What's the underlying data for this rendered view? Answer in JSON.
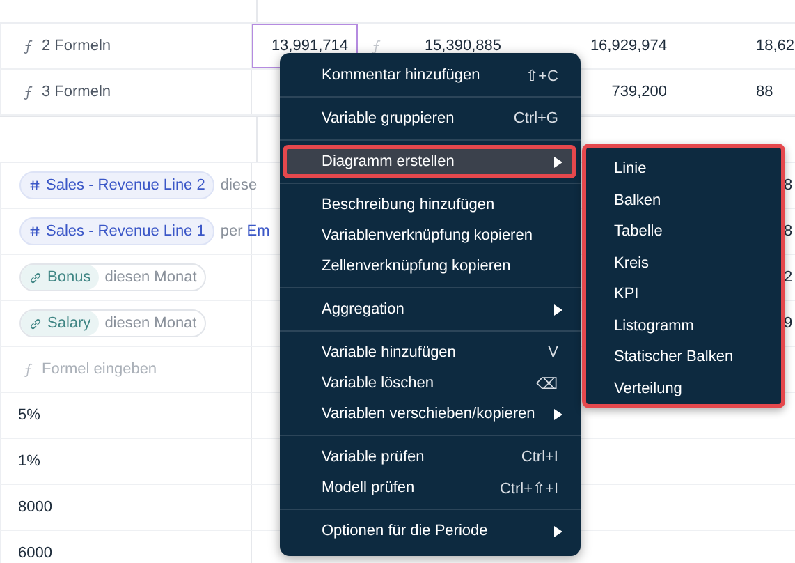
{
  "grid": {
    "groups": [
      {
        "rows": [
          {
            "kind": "formula",
            "label": "2 Formeln",
            "cells": [
              {
                "text": "13,991,714",
                "selected": true,
                "kind": "value"
              },
              {
                "text": "15,390,885",
                "selected": false,
                "kind": "formula"
              },
              {
                "text": "16,929,974",
                "selected": false,
                "kind": "value"
              },
              {
                "text": "18,62",
                "selected": false,
                "kind": "value"
              }
            ]
          },
          {
            "kind": "formula",
            "label": "3 Formeln",
            "cells": [
              null,
              null,
              {
                "text": "739,200",
                "selected": false,
                "kind": "value"
              },
              {
                "text": "88",
                "selected": false,
                "kind": "value"
              }
            ]
          }
        ]
      },
      {
        "rows": [
          {
            "kind": "reference",
            "chip": {
              "kind": "variable",
              "label": "Sales - Revenue Line 2"
            },
            "parts": [
              {
                "kind": "muted",
                "text": "diese"
              }
            ],
            "cells": [
              null,
              null,
              null,
              {
                "text": "8",
                "selected": false,
                "kind": "value"
              }
            ]
          },
          {
            "kind": "reference",
            "chip": {
              "kind": "variable",
              "label": "Sales - Revenue Line 1"
            },
            "parts": [
              {
                "kind": "muted",
                "text": "per"
              },
              {
                "kind": "ref",
                "text": "Em"
              }
            ],
            "cells": [
              null,
              null,
              null,
              {
                "text": "8",
                "selected": false,
                "kind": "value"
              }
            ]
          },
          {
            "kind": "reference",
            "chip": {
              "kind": "link",
              "label": "Bonus"
            },
            "parts": [
              {
                "kind": "muted",
                "text": "diesen Monat"
              }
            ],
            "cells": [
              null,
              null,
              null,
              {
                "text": "2",
                "selected": false,
                "kind": "value"
              }
            ]
          },
          {
            "kind": "reference",
            "chip": {
              "kind": "link",
              "label": "Salary"
            },
            "parts": [
              {
                "kind": "muted",
                "text": "diesen Monat"
              }
            ],
            "cells": [
              null,
              null,
              null,
              {
                "text": "9",
                "selected": false,
                "kind": "value"
              }
            ]
          },
          {
            "kind": "input",
            "placeholder": "Formel eingeben",
            "cells": []
          },
          {
            "kind": "plain",
            "label": "5%",
            "cells": []
          },
          {
            "kind": "plain",
            "label": "1%",
            "cells": []
          },
          {
            "kind": "plain",
            "label": "8000",
            "cells": []
          },
          {
            "kind": "plain",
            "label": "6000",
            "cells": []
          }
        ]
      }
    ]
  },
  "context_menu": {
    "sections": [
      {
        "items": [
          {
            "kind": "action",
            "label": "Kommentar hinzufügen",
            "shortcut": "⇧+C",
            "selected": false
          }
        ]
      },
      {
        "items": [
          {
            "kind": "action",
            "label": "Variable gruppieren",
            "shortcut": "Ctrl+G",
            "selected": false
          }
        ]
      },
      {
        "items": [
          {
            "kind": "submenu",
            "label": "Diagramm erstellen",
            "selected": true,
            "annotated": true
          }
        ]
      },
      {
        "items": [
          {
            "kind": "action",
            "label": "Beschreibung hinzufügen",
            "selected": false
          },
          {
            "kind": "action",
            "label": "Variablenverknüpfung kopieren",
            "selected": false
          },
          {
            "kind": "action",
            "label": "Zellenverknüpfung kopieren",
            "selected": false
          }
        ]
      },
      {
        "items": [
          {
            "kind": "submenu",
            "label": "Aggregation",
            "selected": false
          }
        ]
      },
      {
        "items": [
          {
            "kind": "action",
            "label": "Variable hinzufügen",
            "shortcut": "V",
            "selected": false
          },
          {
            "kind": "action",
            "label": "Variable löschen",
            "shortcut": "⌫",
            "selected": false
          },
          {
            "kind": "submenu",
            "label": "Variablen verschieben/kopieren",
            "selected": false
          }
        ]
      },
      {
        "items": [
          {
            "kind": "action",
            "label": "Variable prüfen",
            "shortcut": "Ctrl+I",
            "selected": false
          },
          {
            "kind": "action",
            "label": "Modell prüfen",
            "shortcut": "Ctrl+⇧+I",
            "selected": false
          }
        ]
      },
      {
        "items": [
          {
            "kind": "submenu",
            "label": "Optionen für die Periode",
            "selected": false
          }
        ]
      }
    ]
  },
  "submenu": {
    "annotated": true,
    "items": [
      "Linie",
      "Balken",
      "Tabelle",
      "Kreis",
      "KPI",
      "Listogramm",
      "Statischer Balken",
      "Verteilung"
    ]
  }
}
